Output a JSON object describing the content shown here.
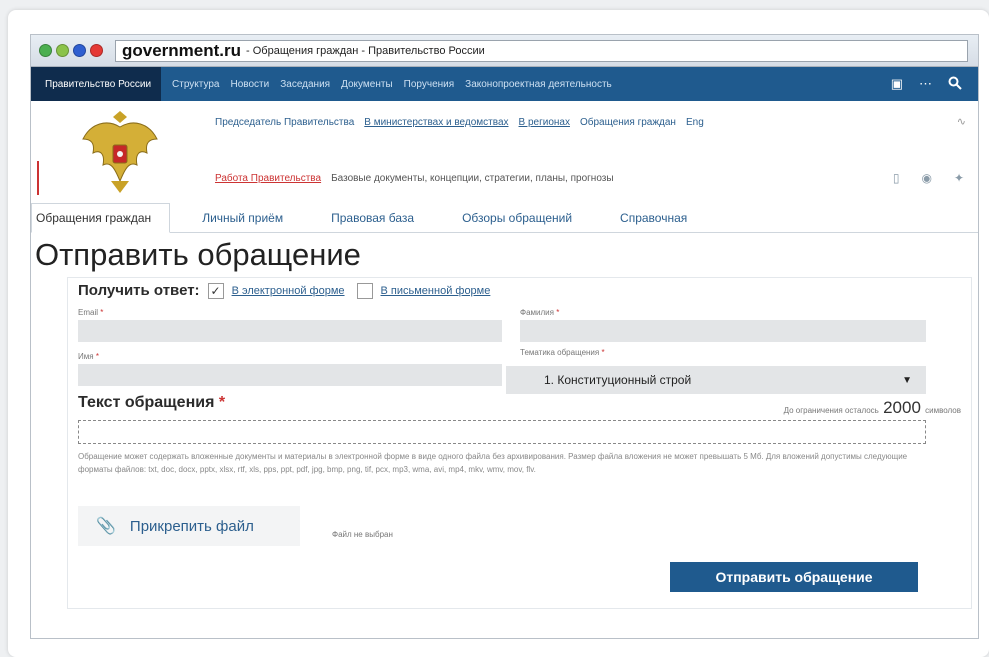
{
  "browser": {
    "host": "government.ru",
    "title_rest": "- Обращения граждан - Правительство России"
  },
  "topnav": {
    "brand": "Правительство России",
    "links": [
      "Структура",
      "Новости",
      "Заседания",
      "Документы",
      "Поручения",
      "Законопроектная деятельность"
    ]
  },
  "subnav1": {
    "items": [
      "Председатель Правительства",
      "В министерствах и ведомствах",
      "В регионах",
      "Обращения граждан",
      "Eng"
    ]
  },
  "subnav2": {
    "highlight": "Работа Правительства",
    "text": "Базовые документы, концепции, стратегии, планы, прогнозы"
  },
  "tabs": [
    "Обращения граждан",
    "Личный приём",
    "Правовая база",
    "Обзоры обращений",
    "Справочная"
  ],
  "page_title": "Отправить обращение",
  "form": {
    "get_answer_label": "Получить ответ:",
    "option_electronic": "В электронной форме",
    "option_paper": "В письменной форме",
    "email_label": "Email",
    "surname_label": "Фамилия",
    "name_label": "Имя",
    "topic_label": "Тематика обращения",
    "topic_value": "1. Конституционный строй",
    "text_label": "Текст обращения",
    "remain_prefix": "До ограничения осталось",
    "remain_count": "2000",
    "remain_suffix": "символов",
    "note": "Обращение может содержать вложенные документы и материалы в электронной форме в виде одного файла без архивирования. Размер файла вложения не может превышать 5 Мб. Для вложений допустимы следующие форматы файлов: txt, doc, docx, pptx, xlsx, rtf, xls, pps, ppt, pdf, jpg, bmp, png, tif, pcx, mp3, wma, avi, mp4, mkv, wmv, mov, flv.",
    "attach_label": "Прикрепить файл",
    "no_file": "Файл не выбран",
    "submit_label": "Отправить обращение"
  },
  "colors": {
    "nav_blue": "#1f5a8e",
    "nav_dark": "#0f2c4d",
    "link_blue": "#2c5f8e",
    "required_red": "#cc3333"
  }
}
